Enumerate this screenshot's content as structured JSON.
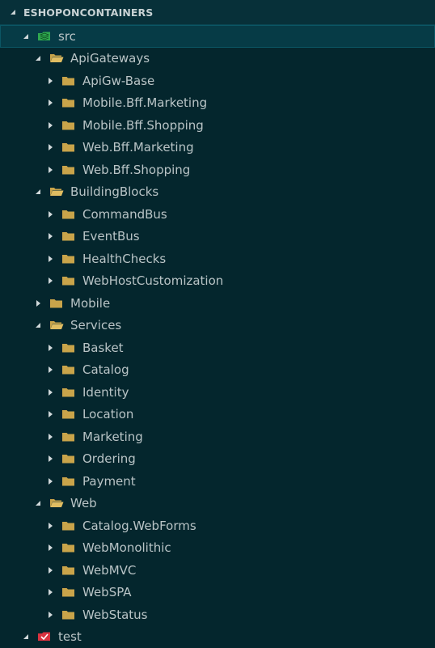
{
  "explorer": {
    "title": "ESHOPONCONTAINERS",
    "items": [
      {
        "label": "src",
        "icon": "src-folder-icon",
        "expanded": true,
        "selected": true
      },
      {
        "label": "ApiGateways",
        "icon": "folder-open-icon",
        "expanded": true
      },
      {
        "label": "ApiGw-Base",
        "icon": "folder-icon",
        "expanded": false
      },
      {
        "label": "Mobile.Bff.Marketing",
        "icon": "folder-icon",
        "expanded": false
      },
      {
        "label": "Mobile.Bff.Shopping",
        "icon": "folder-icon",
        "expanded": false
      },
      {
        "label": "Web.Bff.Marketing",
        "icon": "folder-icon",
        "expanded": false
      },
      {
        "label": "Web.Bff.Shopping",
        "icon": "folder-icon",
        "expanded": false
      },
      {
        "label": "BuildingBlocks",
        "icon": "folder-open-icon",
        "expanded": true
      },
      {
        "label": "CommandBus",
        "icon": "folder-icon",
        "expanded": false
      },
      {
        "label": "EventBus",
        "icon": "folder-icon",
        "expanded": false
      },
      {
        "label": "HealthChecks",
        "icon": "folder-icon",
        "expanded": false
      },
      {
        "label": "WebHostCustomization",
        "icon": "folder-icon",
        "expanded": false
      },
      {
        "label": "Mobile",
        "icon": "folder-icon",
        "expanded": false
      },
      {
        "label": "Services",
        "icon": "folder-open-icon",
        "expanded": true
      },
      {
        "label": "Basket",
        "icon": "folder-icon",
        "expanded": false
      },
      {
        "label": "Catalog",
        "icon": "folder-icon",
        "expanded": false
      },
      {
        "label": "Identity",
        "icon": "folder-icon",
        "expanded": false
      },
      {
        "label": "Location",
        "icon": "folder-icon",
        "expanded": false
      },
      {
        "label": "Marketing",
        "icon": "folder-icon",
        "expanded": false
      },
      {
        "label": "Ordering",
        "icon": "folder-icon",
        "expanded": false
      },
      {
        "label": "Payment",
        "icon": "folder-icon",
        "expanded": false
      },
      {
        "label": "Web",
        "icon": "folder-open-icon",
        "expanded": true
      },
      {
        "label": "Catalog.WebForms",
        "icon": "folder-icon",
        "expanded": false
      },
      {
        "label": "WebMonolithic",
        "icon": "folder-icon",
        "expanded": false
      },
      {
        "label": "WebMVC",
        "icon": "folder-icon",
        "expanded": false
      },
      {
        "label": "WebSPA",
        "icon": "folder-icon",
        "expanded": false
      },
      {
        "label": "WebStatus",
        "icon": "folder-icon",
        "expanded": false
      },
      {
        "label": "test",
        "icon": "test-folder-icon",
        "expanded": true
      }
    ]
  },
  "colors": {
    "background": "#04262d",
    "header": "#073039",
    "selected": "#063b46",
    "folder": "#c9a44a",
    "src_folder": "#2fa84f",
    "test_folder": "#d8323f",
    "text": "#b9c4c6"
  }
}
